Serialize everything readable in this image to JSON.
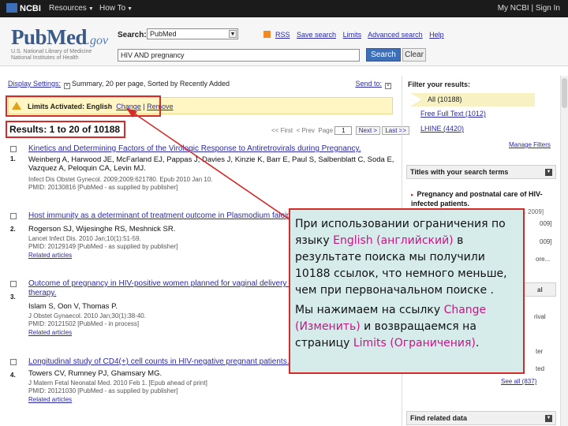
{
  "topbar": {
    "brand": "NCBI",
    "resources": "Resources",
    "howto": "How To",
    "account": "My NCBI | Sign In"
  },
  "header": {
    "logo_pub": "PubMed",
    "logo_gov": ".gov",
    "nlm_line1": "U.S. National Library of Medicine",
    "nlm_line2": "National Institutes of Health",
    "search_label": "Search:",
    "database": "PubMed",
    "links": [
      "RSS",
      "Save search",
      "Limits",
      "Advanced search",
      "Help"
    ],
    "query": "HIV AND pregnancy",
    "search_button": "Search",
    "clear_button": "Clear"
  },
  "display": {
    "settings_label": "Display Settings:",
    "settings_value": "Summary, 20 per page, Sorted by Recently Added",
    "send_to": "Send to:"
  },
  "limits": {
    "label": "Limits Activated: English",
    "change": "Change",
    "remove": "Remove"
  },
  "results": {
    "count_text": "Results: 1 to 20 of 10188",
    "pager": {
      "first": "<< First",
      "prev": "< Prev",
      "page_label": "Page",
      "page": "1",
      "next": "Next >",
      "last": "Last >>"
    },
    "items": [
      {
        "num": "1.",
        "title": "Kinetics and Determining Factors of the Virologic Response to Antiretrovirals during Pregnancy.",
        "authors": "Weinberg A, Harwood JE, McFarland EJ, Pappas J, Davies J, Kinzie K, Barr E, Paul S, Salbenblatt C, Soda E, Vazquez A, Peloquin CA, Levin MJ.",
        "journal": "Infect Dis Obstet Gynecol. 2009;2009:621780. Epub 2010 Jan 10.",
        "pmid": "PMID: 20130816 [PubMed - as supplied by publisher]",
        "related": ""
      },
      {
        "num": "2.",
        "title": "Host immunity as a determinant of treatment outcome in Plasmodium falciparum",
        "authors": "Rogerson SJ, Wijesinghe RS, Meshnick SR.",
        "journal": "Lancet Infect Dis. 2010 Jan;10(1):51-59.",
        "pmid": "PMID: 20129149 [PubMed - as supplied by publisher]",
        "related": "Related articles"
      },
      {
        "num": "3.",
        "title": "Outcome of pregnancy in HIV-positive women planned for vaginal delivery un",
        "title2": "therapy.",
        "authors": "Islam S, Oon V, Thomas P.",
        "journal": "J Obstet Gynaecol. 2010 Jan;30(1):38-40.",
        "pmid": "PMID: 20121502 [PubMed - in process]",
        "related": "Related articles"
      },
      {
        "num": "4.",
        "title": "Longitudinal study of CD4(+) cell counts in HIV-negative pregnant patients.",
        "authors": "Towers CV, Rumney PJ, Ghamsary MG.",
        "journal": "J Matern Fetal Neonatal Med. 2010 Feb 1. [Epub ahead of print]",
        "pmid": "PMID: 20121030 [PubMed - as supplied by publisher]",
        "related": "Related articles"
      }
    ]
  },
  "sidebar": {
    "filter_title": "Filter your results:",
    "all": "All (10188)",
    "free_full_text": "Free Full Text (1012)",
    "lhine": "LHINE (4420)",
    "manage_filters": "Manage Filters",
    "titles_heading": "Titles with your search terms",
    "titles_item": "Pregnancy and postnatal care of HIV-infected patients.",
    "titles_item_src": "[Clin Infect Dis. 2009]",
    "frag_1": "009]",
    "frag_2": "009]",
    "frag_3": "ore...",
    "frag_4": "al",
    "frag_5": "rival",
    "frag_6": "ter",
    "frag_7": "ted",
    "see_all": "See all (837)",
    "find_related": "Find related data"
  },
  "callout": {
    "p1_a": "При использовании ограничения по языку ",
    "p1_hl": "English (английский)",
    "p1_b": " в результате поиска мы получили 10188 ссылок, что немного меньше, чем при первоначальном поиске .",
    "p2_a": "Мы нажимаем на ссылку ",
    "p2_hl1": "Change (Изменить)",
    "p2_b": " и возвращаемся на страницу ",
    "p2_hl2": "Limits (Ограничения)",
    "p2_c": "."
  },
  "colors": {
    "accent_red": "#d42a2a",
    "pubmed_blue": "#3c5a88",
    "link_blue": "#2a2aa8",
    "callout_bg": "#d6eceb",
    "highlight_magenta": "#c71585"
  }
}
